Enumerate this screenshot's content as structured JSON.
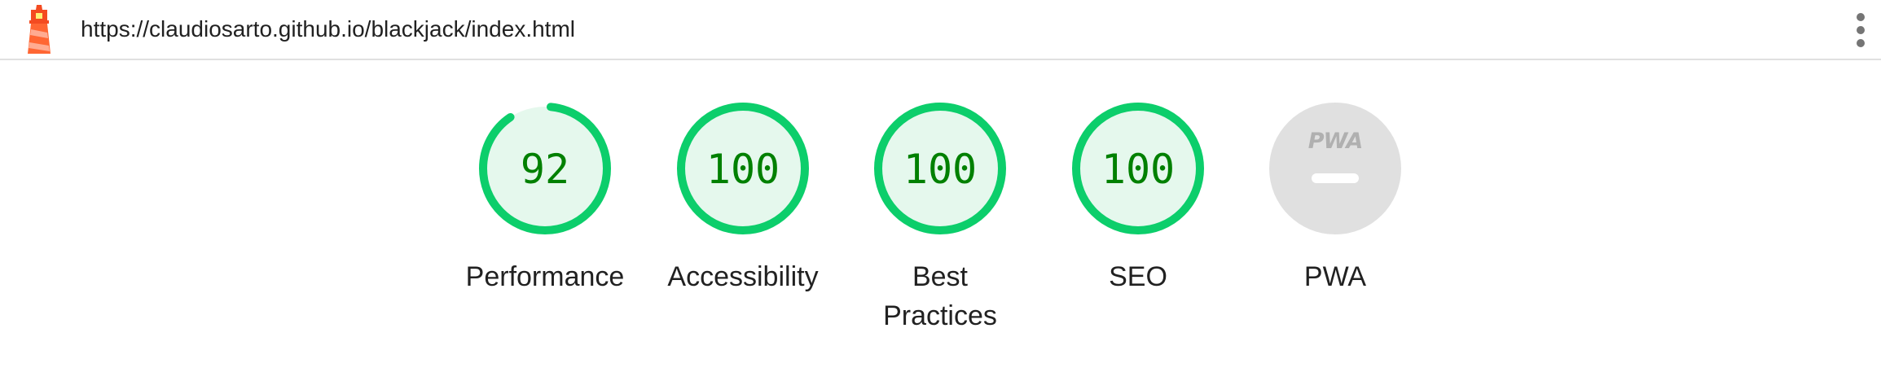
{
  "header": {
    "url": "https://claudiosarto.github.io/blackjack/index.html",
    "logo_icon": "lighthouse-icon",
    "menu_icon": "more-vert-icon"
  },
  "colors": {
    "pass": "#0cce6b",
    "pass_fill": "#e5f8ed",
    "pass_text": "#008000",
    "na_fill": "#e0e0e0",
    "na_mark": "#ffffff",
    "na_badge": "#b0b0b0"
  },
  "gauges": [
    {
      "label": "Performance",
      "score": "92",
      "value": 92
    },
    {
      "label": "Accessibility",
      "score": "100",
      "value": 100
    },
    {
      "label": "Best Practices",
      "score": "100",
      "value": 100
    },
    {
      "label": "SEO",
      "score": "100",
      "value": 100
    },
    {
      "label": "PWA",
      "badge": "PWA",
      "value": null
    }
  ]
}
